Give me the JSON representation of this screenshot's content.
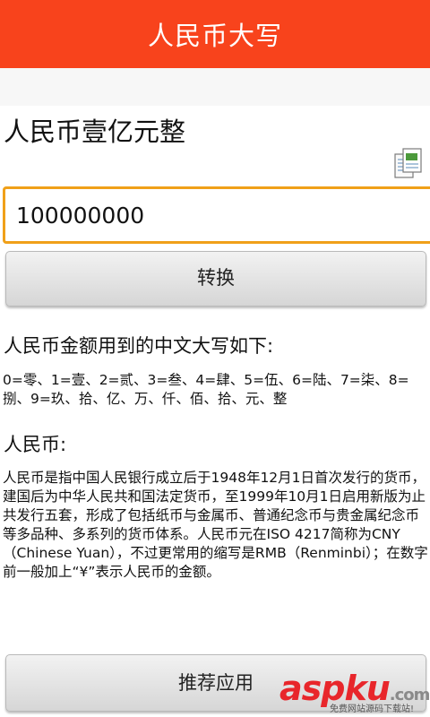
{
  "app": {
    "title": "人民币大写"
  },
  "result_text": "人民币壹亿元整",
  "amount_input": {
    "value": "100000000"
  },
  "convert_button": {
    "label": "转换"
  },
  "info": {
    "heading1": "人民币金额用到的中文大写如下:",
    "digits": "0=零、1=壹、2=贰、3=叁、4=肆、5=伍、6=陆、7=柒、8=捌、9=玖、拾、亿、万、仟、佰、拾、元、整",
    "heading2": "人民币:",
    "description": "人民币是指中国人民银行成立后于1948年12月1日首次发行的货币，建国后为中华人民共和国法定货币，至1999年10月1日启用新版为止共发行五套，形成了包括纸币与金属币、普通纪念币与贵金属纪念币等多品种、多系列的货币体系。人民币元在ISO 4217简称为CNY（Chinese Yuan），不过更常用的缩写是RMB（Renminbi）；在数字前一般加上“¥”表示人民币的金额。"
  },
  "recommend_button": {
    "label": "推荐应用"
  },
  "watermark": {
    "logo": "aspku",
    "domain": ".com",
    "tagline": "免费网站源码下载站!"
  },
  "icons": {
    "copy": "copy-document-icon"
  },
  "colors": {
    "titlebar": "#f8431c",
    "input_border": "#f0a019",
    "watermark": "#e8262b"
  }
}
